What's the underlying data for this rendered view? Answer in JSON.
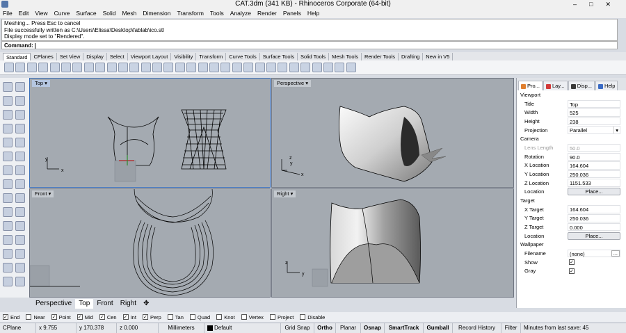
{
  "window": {
    "title": "CAT.3dm (341 KB) - Rhinoceros Corporate (64-bit)"
  },
  "menu": [
    "File",
    "Edit",
    "View",
    "Curve",
    "Surface",
    "Solid",
    "Mesh",
    "Dimension",
    "Transform",
    "Tools",
    "Analyze",
    "Render",
    "Panels",
    "Help"
  ],
  "command_history": [
    "Meshing... Press Esc to cancel",
    "File successfully written as C:\\Users\\Elissa\\Desktop\\fablab\\ico.stl",
    "Display mode set to \"Rendered\"."
  ],
  "command_prompt": "Command:",
  "toolbar_tabs": [
    "Standard",
    "CPlanes",
    "Set View",
    "Display",
    "Select",
    "Viewport Layout",
    "Visibility",
    "Transform",
    "Curve Tools",
    "Surface Tools",
    "Solid Tools",
    "Mesh Tools",
    "Render Tools",
    "Drafting",
    "New in V5"
  ],
  "viewports": {
    "top": "Top",
    "perspective": "Perspective",
    "front": "Front",
    "right": "Right"
  },
  "axis_labels": {
    "x": "x",
    "y": "y",
    "z": "z"
  },
  "bottom_tabs": [
    "Perspective",
    "Top",
    "Front",
    "Right"
  ],
  "panel": {
    "tabs": [
      "Pro...",
      "Lay...",
      "Disp...",
      "Help"
    ],
    "viewport_section": "Viewport",
    "viewport_rows": [
      {
        "label": "Title",
        "value": "Top"
      },
      {
        "label": "Width",
        "value": "525"
      },
      {
        "label": "Height",
        "value": "238"
      },
      {
        "label": "Projection",
        "value": "Parallel"
      }
    ],
    "camera_section": "Camera",
    "camera_rows": [
      {
        "label": "Lens Length",
        "value": "50.0"
      },
      {
        "label": "Rotation",
        "value": "90.0"
      },
      {
        "label": "X Location",
        "value": "164.604"
      },
      {
        "label": "Y Location",
        "value": "250.036"
      },
      {
        "label": "Z Location",
        "value": "1151.533"
      },
      {
        "label": "Location",
        "value": "Place..."
      }
    ],
    "target_section": "Target",
    "target_rows": [
      {
        "label": "X Target",
        "value": "164.604"
      },
      {
        "label": "Y Target",
        "value": "250.036"
      },
      {
        "label": "Z Target",
        "value": "0.000"
      },
      {
        "label": "Location",
        "value": "Place..."
      }
    ],
    "wallpaper_section": "Wallpaper",
    "wallpaper_rows": [
      {
        "label": "Filename",
        "value": "(none)"
      },
      {
        "label": "Show",
        "value": "✓"
      },
      {
        "label": "Gray",
        "value": "✓"
      }
    ]
  },
  "osnaps": [
    {
      "label": "End",
      "checked": true
    },
    {
      "label": "Near",
      "checked": false
    },
    {
      "label": "Point",
      "checked": true
    },
    {
      "label": "Mid",
      "checked": true
    },
    {
      "label": "Cen",
      "checked": true
    },
    {
      "label": "Int",
      "checked": true
    },
    {
      "label": "Perp",
      "checked": true
    },
    {
      "label": "Tan",
      "checked": false
    },
    {
      "label": "Quad",
      "checked": false
    },
    {
      "label": "Knot",
      "checked": false
    },
    {
      "label": "Vertex",
      "checked": false
    },
    {
      "label": "Project",
      "checked": false
    },
    {
      "label": "Disable",
      "checked": false
    }
  ],
  "status": {
    "cplane": "CPlane",
    "x": "x 9.755",
    "y": "y 170.378",
    "z": "z 0.000",
    "units": "Millimeters",
    "layer": "Default",
    "grid_snap": "Grid Snap",
    "ortho": "Ortho",
    "planar": "Planar",
    "osnap": "Osnap",
    "smarttrack": "SmartTrack",
    "gumball": "Gumball",
    "record_history": "Record History",
    "filter": "Filter",
    "autosave": "Minutes from last save: 45"
  },
  "colors": {
    "viewport_bg": "#a4aab1",
    "active_border": "#3b6fb8",
    "layer_swatch": "#000000"
  }
}
